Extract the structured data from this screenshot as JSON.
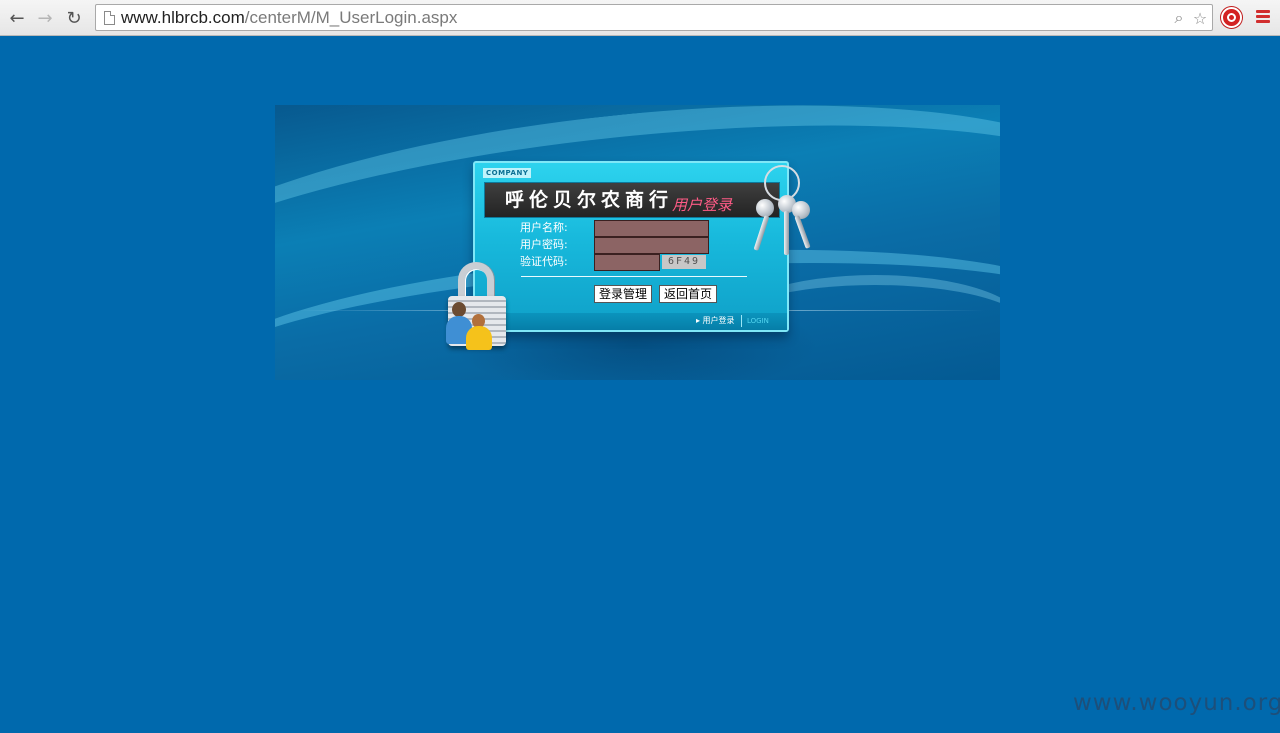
{
  "browser": {
    "url_host": "www.hlbrcb.com",
    "url_path": "/centerM/M_UserLogin.aspx",
    "back_icon": "back-arrow-icon",
    "forward_icon": "forward-arrow-icon",
    "reload_icon": "reload-icon",
    "page_icon": "page-icon",
    "search_icon": "magnifier-icon",
    "bookmark_icon": "star-icon",
    "extension_icon": "adblock-stop-icon",
    "menu_icon": "hamburger-menu-icon"
  },
  "login": {
    "company_tag": "COMPANY",
    "bank_name": "呼伦贝尔农商行",
    "subtitle": "用户登录",
    "fields": {
      "username_label": "用户名称:",
      "password_label": "用户密码:",
      "captcha_label": "验证代码:",
      "username_value": "",
      "password_value": "",
      "captcha_value": ""
    },
    "captcha_code": "6F49",
    "buttons": {
      "login": "登录管理",
      "home": "返回首页"
    },
    "footer": {
      "link": "▸ 用户登录",
      "login": "LOGIN"
    }
  },
  "watermark": "www.wooyun.org",
  "colors": {
    "page_background": "#0069ad",
    "panel": "#1ebbe0",
    "input_fill": "#8c6464",
    "subtitle": "#ff5b86"
  }
}
